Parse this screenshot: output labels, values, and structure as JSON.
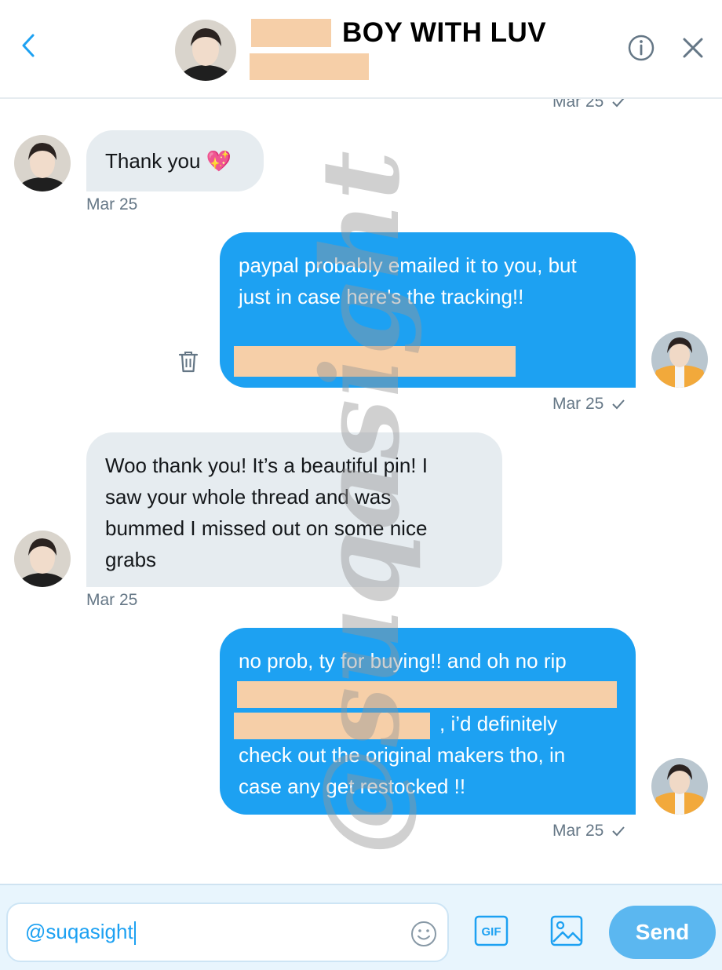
{
  "header": {
    "title": "BOY WITH LUV",
    "back_icon": "chevron-left-icon",
    "info_icon": "info-icon",
    "close_icon": "close-icon"
  },
  "messages": [
    {
      "direction": "outgoing",
      "timestamp": "Mar 25",
      "partially_visible": true
    },
    {
      "direction": "incoming",
      "text": "Thank you 💖",
      "timestamp": "Mar 25"
    },
    {
      "direction": "outgoing",
      "lines": [
        "paypal probably emailed it to you, but",
        "just in case here's the tracking!!"
      ],
      "timestamp": "Mar 25"
    },
    {
      "direction": "incoming",
      "lines": [
        "Woo thank you! It’s a beautiful pin! I",
        "saw your whole thread and was",
        "bummed I missed out on some nice",
        "grabs"
      ],
      "timestamp": "Mar 25"
    },
    {
      "direction": "outgoing",
      "lines": [
        "no prob, ty for buying!! and oh no rip",
        "i’d definitely",
        "check out the original makers tho, in",
        "case any get restocked !!"
      ],
      "timestamp": "Mar 25"
    }
  ],
  "composer": {
    "input_value": "@suqasight",
    "gif_label": "GIF",
    "send_label": "Send"
  },
  "watermark": "@suqasight",
  "colors": {
    "accent": "#1da1f2",
    "incoming_bubble": "#e6ecf0",
    "redaction": "#f6cfa8",
    "composer_bg": "#e8f5fd"
  }
}
